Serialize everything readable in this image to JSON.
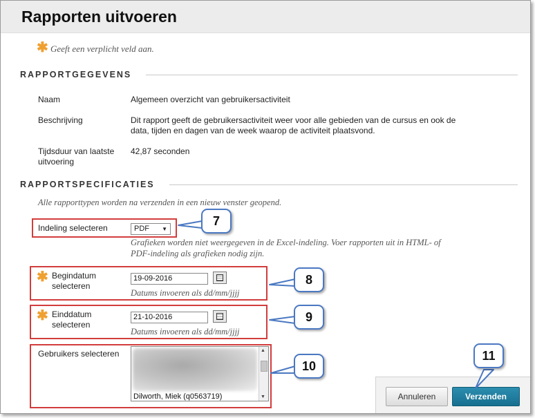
{
  "page": {
    "title": "Rapporten uitvoeren"
  },
  "required_note": "Geeft een verplicht veld aan.",
  "report_details": {
    "heading": "RAPPORTGEGEVENS",
    "name_label": "Naam",
    "name_value": "Algemeen overzicht van gebruikersactiviteit",
    "description_label": "Beschrijving",
    "description_line1": "Dit rapport geeft de gebruikersactiviteit weer voor alle gebieden van de cursus en ook de",
    "description_line2": "data, tijden en dagen van de week waarop de activiteit plaatsvond.",
    "duration_label_line1": "Tijdsduur van laatste",
    "duration_label_line2": "uitvoering",
    "duration_value": "42,87 seconden"
  },
  "report_specs": {
    "heading": "RAPPORTSPECIFICATIES",
    "intro": "Alle rapporttypen worden na verzenden in een nieuw venster geopend.",
    "format_label": "Indeling selecteren",
    "format_value": "PDF",
    "format_hint_line1": "Grafieken worden niet weergegeven in de Excel-indeling. Voer rapporten uit in HTML- of",
    "format_hint_line2": "PDF-indeling als grafieken nodig zijn.",
    "start_label_line1": "Begindatum",
    "start_label_line2": "selecteren",
    "start_value": "19-09-2016",
    "end_label_line1": "Einddatum",
    "end_label_line2": "selecteren",
    "end_value": "21-10-2016",
    "date_hint": "Datums invoeren als dd/mm/jjjj",
    "users_label": "Gebruikers selecteren",
    "users_last_visible": "Dilworth, Miek (q0563719)"
  },
  "buttons": {
    "cancel": "Annuleren",
    "submit": "Verzenden"
  },
  "callouts": {
    "c7": "7",
    "c8": "8",
    "c9": "9",
    "c10": "10",
    "c11": "11"
  },
  "icons": {
    "required": "asterisk-icon",
    "calendar": "calendar-icon",
    "dropdown": "chevron-down-icon"
  },
  "colors": {
    "required_star": "#f0a030",
    "highlight_box": "#d23c3c",
    "callout_border": "#4a78c2",
    "submit_button": "#1e7ea1"
  }
}
